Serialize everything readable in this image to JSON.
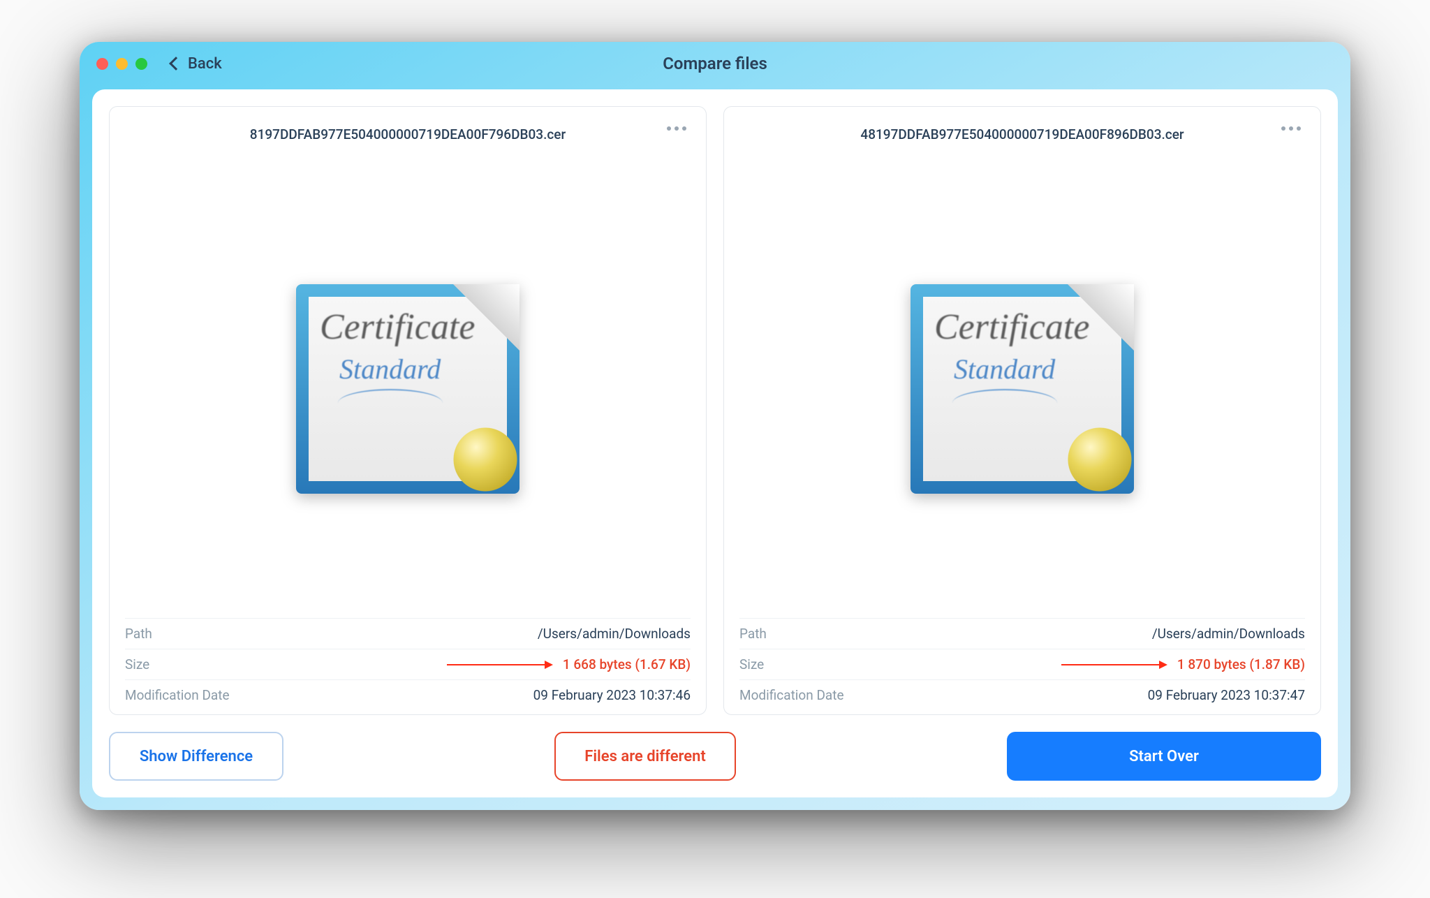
{
  "window": {
    "title": "Compare files",
    "back_label": "Back"
  },
  "labels": {
    "path": "Path",
    "size": "Size",
    "modification_date": "Modification Date"
  },
  "icon": {
    "cert_text1": "Certificate",
    "cert_text2": "Standard"
  },
  "files": [
    {
      "name": "8197DDFAB977E504000000719DEA00F796DB03.cer",
      "path": "/Users/admin/Downloads",
      "size": "1 668 bytes (1.67 KB)",
      "modification_date": "09 February 2023 10:37:46",
      "size_differs": true
    },
    {
      "name": "48197DDFAB977E504000000719DEA00F896DB03.cer",
      "path": "/Users/admin/Downloads",
      "size": "1 870 bytes (1.87 KB)",
      "modification_date": "09 February 2023 10:37:47",
      "size_differs": true
    }
  ],
  "actions": {
    "show_difference": "Show Difference",
    "status": "Files are different",
    "start_over": "Start Over"
  }
}
